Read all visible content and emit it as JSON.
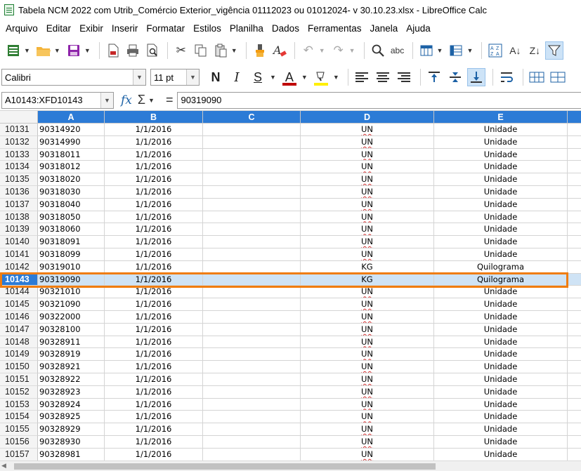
{
  "window": {
    "title": "Tabela NCM 2022 com Utrib_Comércio Exterior_vigência  01112023 ou 01012024- v 30.10.23.xlsx - LibreOffice Calc"
  },
  "menu": [
    "Arquivo",
    "Editar",
    "Exibir",
    "Inserir",
    "Formatar",
    "Estilos",
    "Planilha",
    "Dados",
    "Ferramentas",
    "Janela",
    "Ajuda"
  ],
  "format_bar": {
    "font_name": "Calibri",
    "font_size": "11 pt",
    "bold": "N",
    "italic": "I",
    "underline": "S",
    "font_color_icon": "A",
    "font_color": "#c00000",
    "highlight_color": "#ffef00"
  },
  "formula_bar": {
    "name_box": "A10143:XFD10143",
    "fx": "fx",
    "sum": "Σ",
    "equals": "=",
    "content": "90319090"
  },
  "columns": [
    "A",
    "B",
    "C",
    "D",
    "E"
  ],
  "selected_row": "10143",
  "accent_color": "#2c7bd6",
  "highlight_outline_color": "#f07d10",
  "rows": [
    {
      "num": "10131",
      "a": "90314920",
      "b": "1/1/2016",
      "c": "",
      "d": "UN",
      "e": "Unidade"
    },
    {
      "num": "10132",
      "a": "90314990",
      "b": "1/1/2016",
      "c": "",
      "d": "UN",
      "e": "Unidade"
    },
    {
      "num": "10133",
      "a": "90318011",
      "b": "1/1/2016",
      "c": "",
      "d": "UN",
      "e": "Unidade"
    },
    {
      "num": "10134",
      "a": "90318012",
      "b": "1/1/2016",
      "c": "",
      "d": "UN",
      "e": "Unidade"
    },
    {
      "num": "10135",
      "a": "90318020",
      "b": "1/1/2016",
      "c": "",
      "d": "UN",
      "e": "Unidade"
    },
    {
      "num": "10136",
      "a": "90318030",
      "b": "1/1/2016",
      "c": "",
      "d": "UN",
      "e": "Unidade"
    },
    {
      "num": "10137",
      "a": "90318040",
      "b": "1/1/2016",
      "c": "",
      "d": "UN",
      "e": "Unidade"
    },
    {
      "num": "10138",
      "a": "90318050",
      "b": "1/1/2016",
      "c": "",
      "d": "UN",
      "e": "Unidade"
    },
    {
      "num": "10139",
      "a": "90318060",
      "b": "1/1/2016",
      "c": "",
      "d": "UN",
      "e": "Unidade"
    },
    {
      "num": "10140",
      "a": "90318091",
      "b": "1/1/2016",
      "c": "",
      "d": "UN",
      "e": "Unidade"
    },
    {
      "num": "10141",
      "a": "90318099",
      "b": "1/1/2016",
      "c": "",
      "d": "UN",
      "e": "Unidade"
    },
    {
      "num": "10142",
      "a": "90319010",
      "b": "1/1/2016",
      "c": "",
      "d": "KG",
      "e": "Quilograma"
    },
    {
      "num": "10143",
      "a": "90319090",
      "b": "1/1/2016",
      "c": "",
      "d": "KG",
      "e": "Quilograma"
    },
    {
      "num": "10144",
      "a": "90321010",
      "b": "1/1/2016",
      "c": "",
      "d": "UN",
      "e": "Unidade"
    },
    {
      "num": "10145",
      "a": "90321090",
      "b": "1/1/2016",
      "c": "",
      "d": "UN",
      "e": "Unidade"
    },
    {
      "num": "10146",
      "a": "90322000",
      "b": "1/1/2016",
      "c": "",
      "d": "UN",
      "e": "Unidade"
    },
    {
      "num": "10147",
      "a": "90328100",
      "b": "1/1/2016",
      "c": "",
      "d": "UN",
      "e": "Unidade"
    },
    {
      "num": "10148",
      "a": "90328911",
      "b": "1/1/2016",
      "c": "",
      "d": "UN",
      "e": "Unidade"
    },
    {
      "num": "10149",
      "a": "90328919",
      "b": "1/1/2016",
      "c": "",
      "d": "UN",
      "e": "Unidade"
    },
    {
      "num": "10150",
      "a": "90328921",
      "b": "1/1/2016",
      "c": "",
      "d": "UN",
      "e": "Unidade"
    },
    {
      "num": "10151",
      "a": "90328922",
      "b": "1/1/2016",
      "c": "",
      "d": "UN",
      "e": "Unidade"
    },
    {
      "num": "10152",
      "a": "90328923",
      "b": "1/1/2016",
      "c": "",
      "d": "UN",
      "e": "Unidade"
    },
    {
      "num": "10153",
      "a": "90328924",
      "b": "1/1/2016",
      "c": "",
      "d": "UN",
      "e": "Unidade"
    },
    {
      "num": "10154",
      "a": "90328925",
      "b": "1/1/2016",
      "c": "",
      "d": "UN",
      "e": "Unidade"
    },
    {
      "num": "10155",
      "a": "90328929",
      "b": "1/1/2016",
      "c": "",
      "d": "UN",
      "e": "Unidade"
    },
    {
      "num": "10156",
      "a": "90328930",
      "b": "1/1/2016",
      "c": "",
      "d": "UN",
      "e": "Unidade"
    },
    {
      "num": "10157",
      "a": "90328981",
      "b": "1/1/2016",
      "c": "",
      "d": "UN",
      "e": "Unidade"
    }
  ]
}
